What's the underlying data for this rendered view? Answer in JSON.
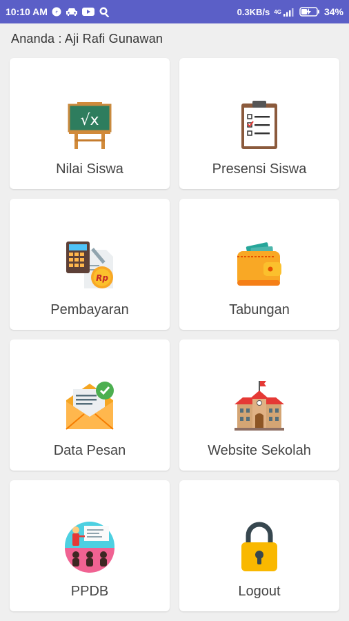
{
  "status_bar": {
    "time": "10:10 AM",
    "speed": "0.3KB/s",
    "network": "4G",
    "battery": "34%",
    "color": "#5b5fc7"
  },
  "greeting": "Ananda :  Aji Rafi Gunawan",
  "menu": [
    {
      "label": "Nilai Siswa",
      "icon": "chalkboard-sqrt-icon"
    },
    {
      "label": "Presensi Siswa",
      "icon": "clipboard-checklist-icon"
    },
    {
      "label": "Pembayaran",
      "icon": "calculator-rp-icon"
    },
    {
      "label": "Tabungan",
      "icon": "wallet-icon"
    },
    {
      "label": "Data Pesan",
      "icon": "envelope-check-icon"
    },
    {
      "label": "Website Sekolah",
      "icon": "school-building-icon"
    },
    {
      "label": "PPDB",
      "icon": "classroom-presentation-icon"
    },
    {
      "label": "Logout",
      "icon": "padlock-icon"
    }
  ]
}
